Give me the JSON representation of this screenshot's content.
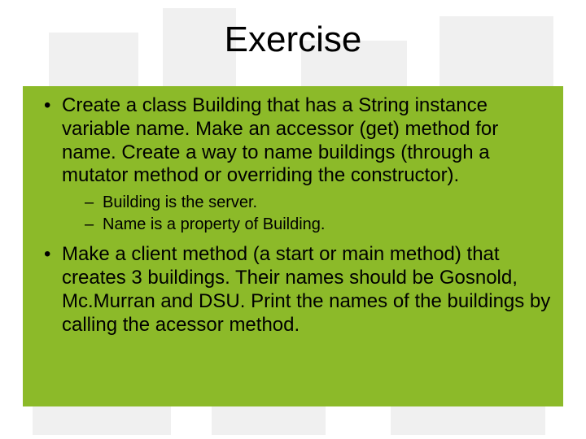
{
  "title": "Exercise",
  "bullets": {
    "item1": "Create a class Building that has a String instance variable name. Make an accessor (get) method for name. Create a way to name buildings (through a mutator method or overriding the constructor).",
    "sub1": "Building is the server.",
    "sub2": "Name is a property of Building.",
    "item2": "Make a client method (a start or main method) that creates 3 buildings. Their names should be Gosnold, Mc.Murran and DSU. Print the names of the buildings by calling the acessor method."
  }
}
